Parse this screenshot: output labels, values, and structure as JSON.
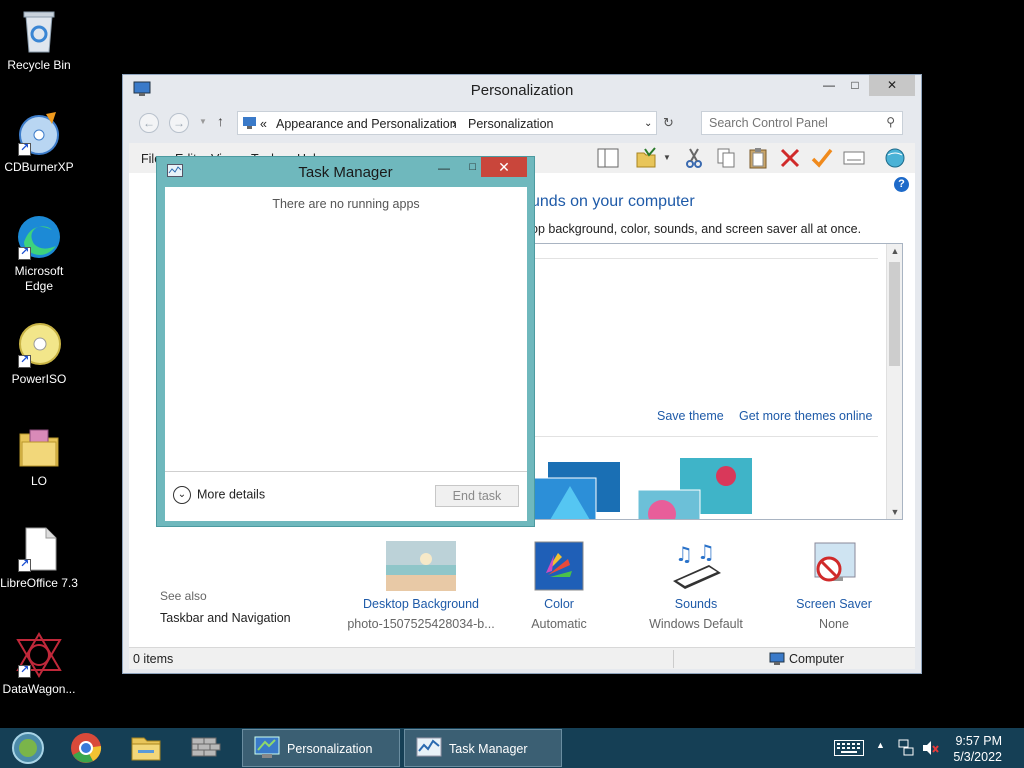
{
  "desktop": {
    "icons": [
      {
        "label": "Recycle Bin"
      },
      {
        "label": "CDBurnerXP"
      },
      {
        "label": "Microsoft Edge"
      },
      {
        "label": "PowerISO"
      },
      {
        "label": "LO"
      },
      {
        "label": "LibreOffice 7.3"
      },
      {
        "label": "DataWagon..."
      }
    ]
  },
  "personalization": {
    "title": "Personalization",
    "breadcrumb": {
      "chevrons": "«",
      "part1": "Appearance and Personalization",
      "sep": "›",
      "part2": "Personalization"
    },
    "search_placeholder": "Search Control Panel",
    "menu": [
      "File",
      "Edit",
      "View",
      "Tools",
      "Help"
    ],
    "heading": "unds on your computer",
    "subheading": "op background, color, sounds, and screen saver all at once.",
    "save_theme": "Save theme",
    "more_themes": "Get more themes online",
    "see_also": "See also",
    "see_also_link": "Taskbar and Navigation",
    "settings": [
      {
        "name": "Desktop Background",
        "value": "photo-1507525428034-b..."
      },
      {
        "name": "Color",
        "value": "Automatic"
      },
      {
        "name": "Sounds",
        "value": "Windows Default"
      },
      {
        "name": "Screen Saver",
        "value": "None"
      }
    ],
    "status_items": "0 items",
    "status_location": "Computer"
  },
  "task_manager": {
    "title": "Task Manager",
    "empty_message": "There are no running apps",
    "more_details": "More details",
    "end_task": "End task"
  },
  "taskbar": {
    "tasks": [
      {
        "label": "Personalization"
      },
      {
        "label": "Task Manager"
      }
    ],
    "time": "9:57 PM",
    "date": "5/3/2022"
  },
  "colors": {
    "taskbar": "#153f55",
    "task_manager_frame": "#6fb8bd",
    "close_red": "#c9463b",
    "link_blue": "#1e5aa8"
  }
}
